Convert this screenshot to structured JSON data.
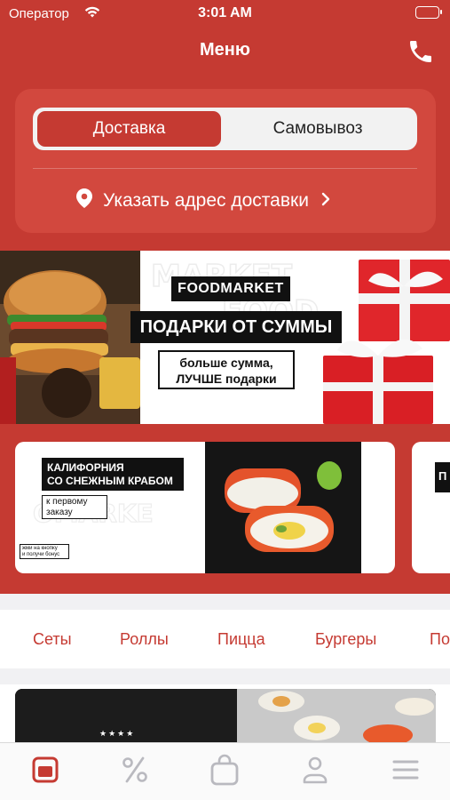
{
  "status_bar": {
    "carrier": "Оператор",
    "time": "3:01 AM",
    "icons": [
      "wifi-icon",
      "battery-icon"
    ]
  },
  "nav": {
    "title": "Меню",
    "phone_icon": "phone-icon"
  },
  "delivery": {
    "mode_options": [
      "Доставка",
      "Самовывоз"
    ],
    "selected_mode": "Доставка",
    "address_prompt": "Указать адрес доставки",
    "pin_icon": "location-pin-icon",
    "chevron_icon": "chevron-right-icon"
  },
  "banner": {
    "brand": "FOODMARKET",
    "title": "ПОДАРКИ ОТ СУММЫ",
    "subtitle_line1": "больше сумма,",
    "subtitle_line2": "ЛУЧШЕ подарки"
  },
  "promos": [
    {
      "title_line1": "КАЛИФОРНИЯ",
      "title_line2": "СО СНЕЖНЫМ КРАБОМ",
      "subtitle_line1": "к первому",
      "subtitle_line2": "заказу",
      "small_line1": "жми на кнопку",
      "small_line2": "и получи бонус"
    },
    {
      "title_line1": "П"
    }
  ],
  "categories": [
    "Сеты",
    "Роллы",
    "Пицца",
    "Бургеры",
    "По"
  ],
  "colors": {
    "brand_red": "#c53a32",
    "card_red": "#d2483e",
    "tab_active": "#c53a32",
    "tab_inactive": "#b9b9bf"
  },
  "tab_bar": {
    "items": [
      {
        "icon": "menu-icon",
        "active": true
      },
      {
        "icon": "percent-icon",
        "active": false
      },
      {
        "icon": "bag-icon",
        "active": false
      },
      {
        "icon": "profile-icon",
        "active": false
      },
      {
        "icon": "hamburger-icon",
        "active": false
      }
    ]
  }
}
